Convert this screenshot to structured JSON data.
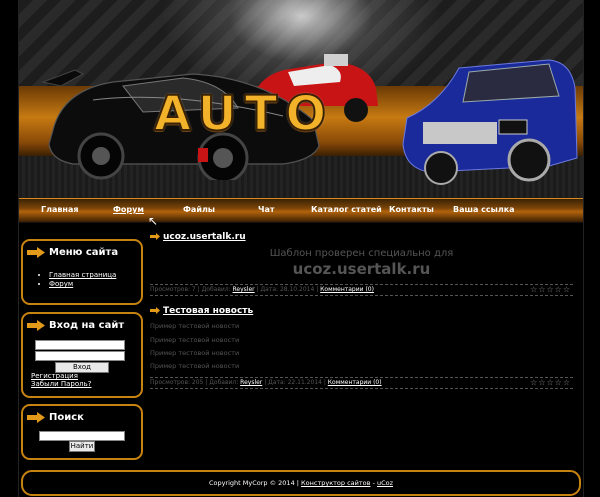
{
  "header": {
    "logo_text": "AUTO"
  },
  "nav": {
    "items": [
      {
        "label": "Главная"
      },
      {
        "label": "Форум"
      },
      {
        "label": "Файлы"
      },
      {
        "label": "Чат"
      },
      {
        "label": "Каталог статей"
      },
      {
        "label": "Контакты"
      },
      {
        "label": "Ваша ссылка"
      }
    ]
  },
  "sidebar": {
    "menu": {
      "title": "Меню сайта",
      "items": [
        {
          "label": "Главная страница"
        },
        {
          "label": "Форум"
        }
      ]
    },
    "login": {
      "title": "Вход на сайт",
      "button": "Вход",
      "register": "Регистрация",
      "forgot": "Забыли Пароль?"
    },
    "search": {
      "title": "Поиск",
      "button": "Найти"
    }
  },
  "content": {
    "post1": {
      "title": "ucoz.usertalk.ru",
      "line1": "Шаблон проверен специально для",
      "line2": "ucoz.usertalk.ru",
      "meta_prefix": "Просмотров: 7 | Добавил:",
      "author": "Reysler",
      "meta_date": "| Дата: 28.10.2014 |",
      "comments": "Комментарии (0)",
      "stars": "☆☆☆☆☆"
    },
    "post2": {
      "title": "Тестовая новость",
      "lines": [
        "Пример тестовой новости",
        "Пример тестовой новости",
        "Пример тестовой новости",
        "Пример тестовой новости"
      ],
      "meta_prefix": "Просмотров: 205 | Добавил:",
      "author": "Reysler",
      "meta_date": "| Дата: 22.11.2014 |",
      "comments": "Комментарии (0)",
      "stars": "☆☆☆☆☆"
    }
  },
  "footer": {
    "copyright": "Copyright MyCorp © 2014 |",
    "constructor": "Конструктор сайтов",
    "sep": "-",
    "ucoz": "uCoz"
  },
  "colors": {
    "accent": "#c7830f",
    "nav": "#b2630c",
    "muted": "#555555"
  }
}
